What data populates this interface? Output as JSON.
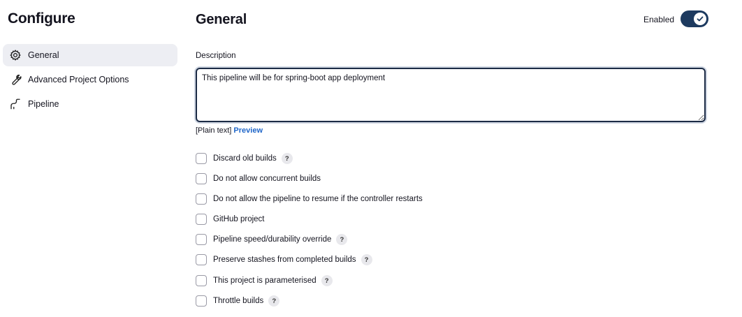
{
  "sidebar": {
    "title": "Configure",
    "items": [
      {
        "label": "General",
        "icon": "gear-icon",
        "active": true
      },
      {
        "label": "Advanced Project Options",
        "icon": "wrench-icon",
        "active": false
      },
      {
        "label": "Pipeline",
        "icon": "pipeline-icon",
        "active": false
      }
    ]
  },
  "header": {
    "title": "General",
    "enabled_label": "Enabled",
    "enabled": true
  },
  "description": {
    "label": "Description",
    "value": "This pipeline will be for spring-boot app deployment",
    "format_text": "[Plain text]",
    "preview_label": "Preview"
  },
  "options": [
    {
      "label": "Discard old builds",
      "checked": false,
      "help": "?"
    },
    {
      "label": "Do not allow concurrent builds",
      "checked": false
    },
    {
      "label": "Do not allow the pipeline to resume if the controller restarts",
      "checked": false
    },
    {
      "label": "GitHub project",
      "checked": false
    },
    {
      "label": "Pipeline speed/durability override",
      "checked": false,
      "help": "?"
    },
    {
      "label": "Preserve stashes from completed builds",
      "checked": false,
      "help": "?"
    },
    {
      "label": "This project is parameterised",
      "checked": false,
      "help": "?"
    },
    {
      "label": "Throttle builds",
      "checked": false,
      "help": "?"
    }
  ],
  "colors": {
    "accent": "#1d3a5f",
    "link": "#1f66c9",
    "active_bg": "#edeef3"
  }
}
